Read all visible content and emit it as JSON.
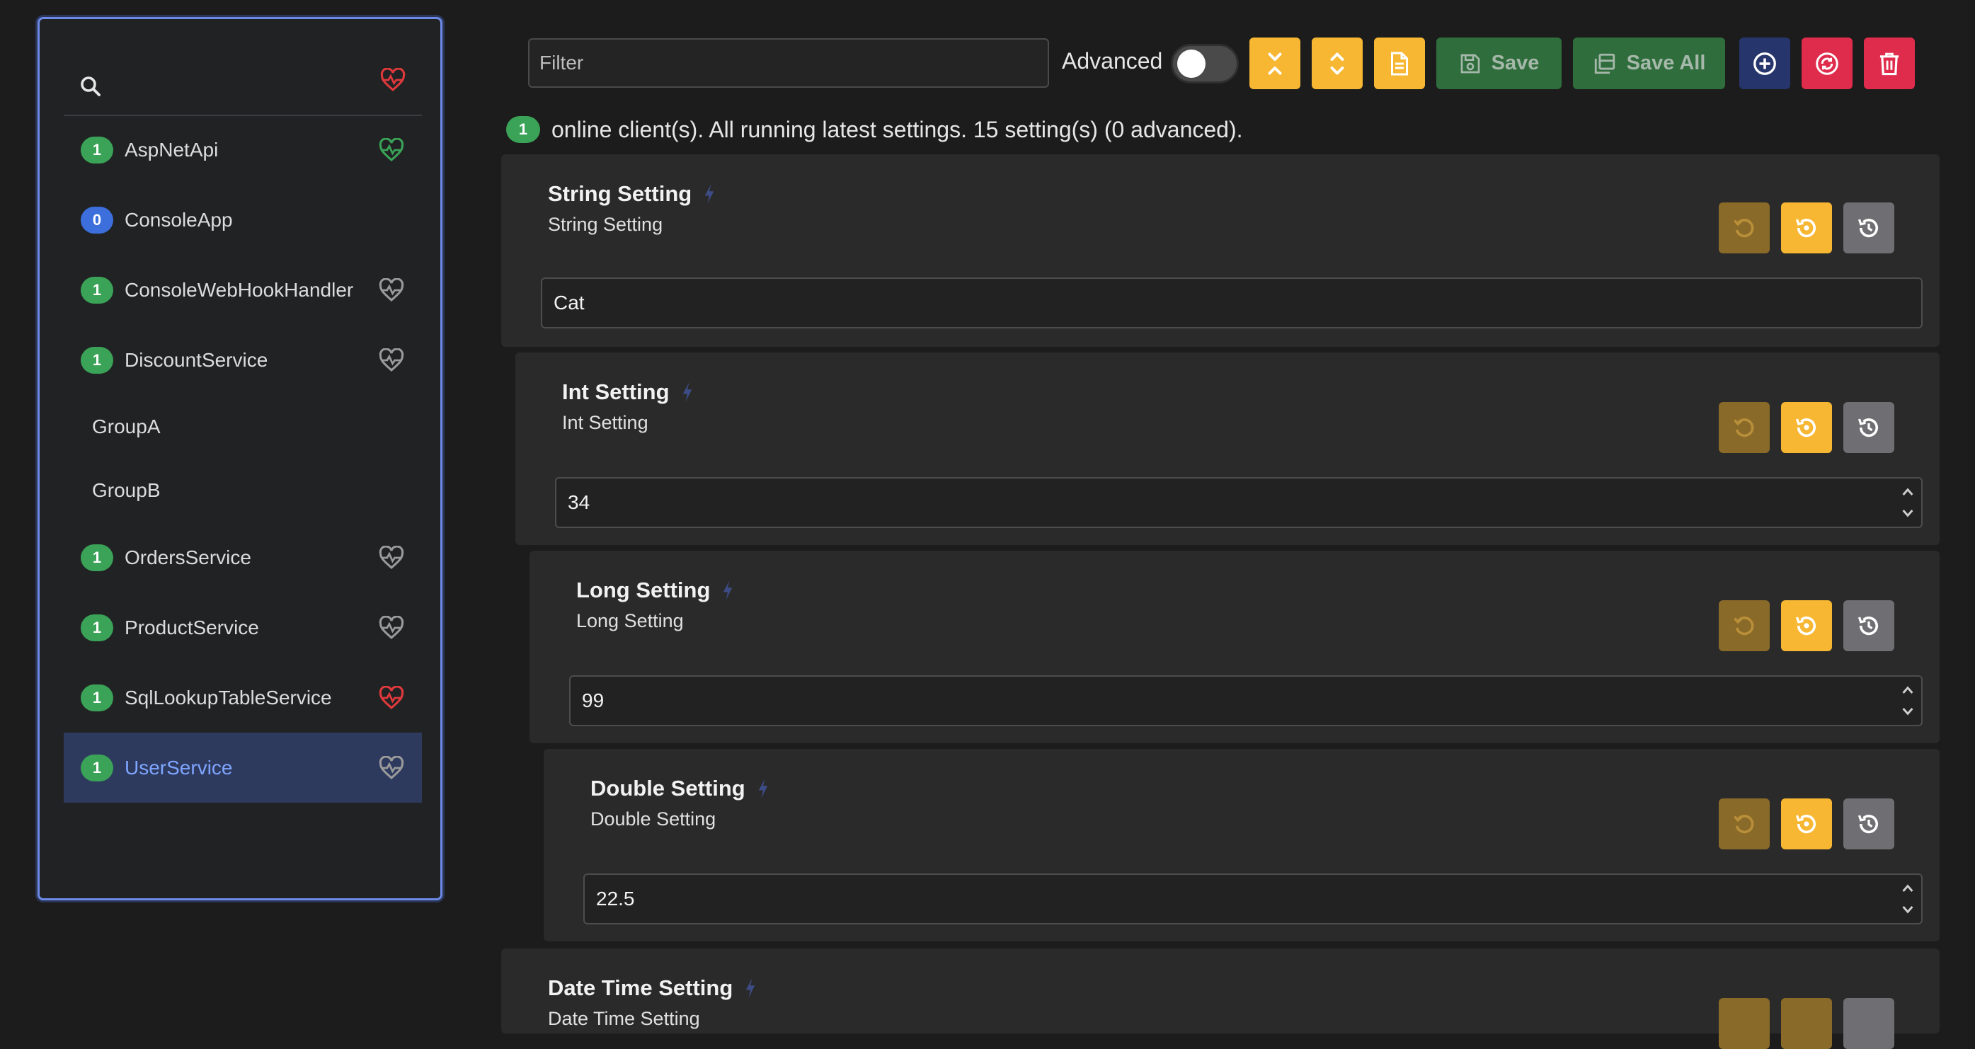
{
  "sidebar": {
    "search_icon": "search-icon",
    "health_icon": "heart-pulse-icon",
    "items": [
      {
        "name": "AspNetApi",
        "count": "1",
        "badge_color": "#3aa357",
        "health": "#3aa357"
      },
      {
        "name": "ConsoleApp",
        "count": "0",
        "badge_color": "#3c6fdc",
        "health": null
      },
      {
        "name": "ConsoleWebHookHandler",
        "count": "1",
        "badge_color": "#3aa357",
        "health": "#9a9a9a"
      },
      {
        "name": "DiscountService",
        "count": "1",
        "badge_color": "#3aa357",
        "health": "#9a9a9a"
      },
      {
        "name": "GroupA",
        "group": true
      },
      {
        "name": "GroupB",
        "group": true
      },
      {
        "name": "OrdersService",
        "count": "1",
        "badge_color": "#3aa357",
        "health": "#9a9a9a"
      },
      {
        "name": "ProductService",
        "count": "1",
        "badge_color": "#3aa357",
        "health": "#9a9a9a"
      },
      {
        "name": "SqlLookupTableService",
        "count": "1",
        "badge_color": "#3aa357",
        "health": "#e0393c"
      },
      {
        "name": "UserService",
        "count": "1",
        "badge_color": "#3aa357",
        "health": "#9a9a9a",
        "selected": true
      }
    ]
  },
  "toolbar": {
    "filter_placeholder": "Filter",
    "advanced_label": "Advanced",
    "advanced_on": false,
    "save_label": "Save",
    "save_all_label": "Save All"
  },
  "status": {
    "online_count": "1",
    "text": "online client(s). All running latest settings. 15 setting(s) (0 advanced)."
  },
  "settings": [
    {
      "title": "String Setting",
      "description": "String Setting",
      "value": "Cat",
      "numeric": false
    },
    {
      "title": "Int Setting",
      "description": "Int Setting",
      "value": "34",
      "numeric": true
    },
    {
      "title": "Long Setting",
      "description": "Long Setting",
      "value": "99",
      "numeric": true
    },
    {
      "title": "Double Setting",
      "description": "Double Setting",
      "value": "22.5",
      "numeric": true
    },
    {
      "title": "Date Time Setting",
      "description": "Date Time Setting"
    }
  ],
  "colors": {
    "accent": "#6c8ae6",
    "warning": "#f7b733",
    "success": "#2f6d3c",
    "danger": "#e02c4c",
    "primary_dark": "#26356b"
  }
}
